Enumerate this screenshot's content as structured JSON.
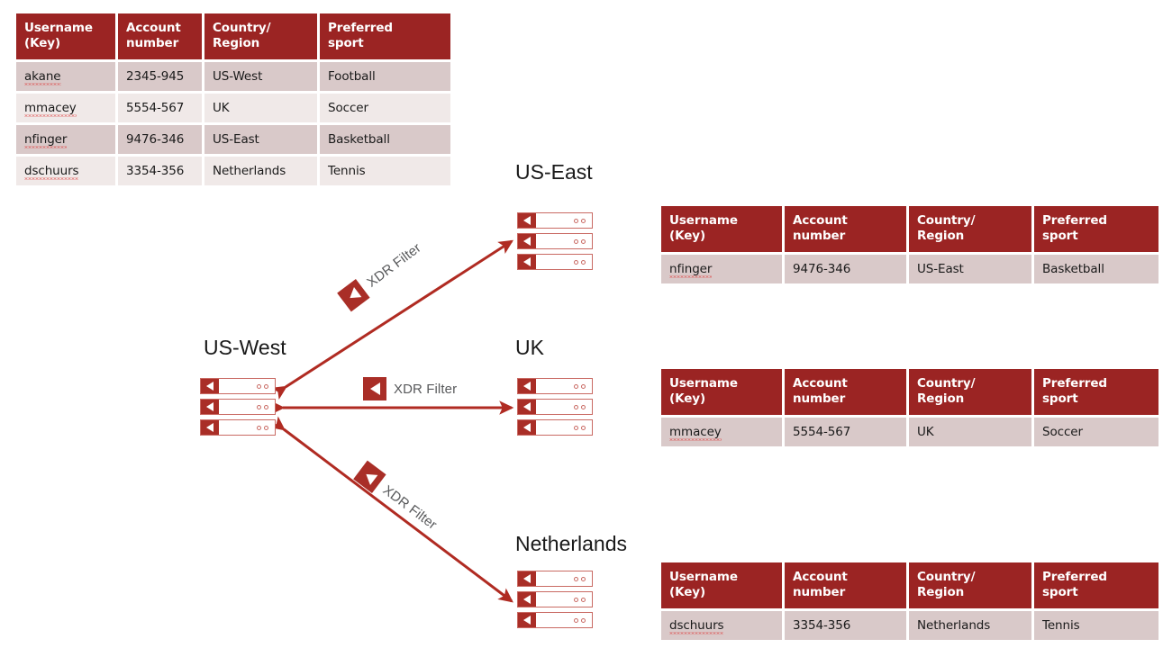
{
  "colors": {
    "header_red": "#9B2423",
    "node_red": "#A92E27",
    "node_border": "#C96A63",
    "arrow_red": "#B02B22",
    "row_odd": "#D9C9C9",
    "row_even": "#F0E9E8",
    "label_gray": "#58595B"
  },
  "tables": {
    "columns": [
      "Username (Key)",
      "Account number",
      "Country/ Region",
      "Preferred sport"
    ],
    "columns_lines": [
      [
        "Username",
        "(Key)"
      ],
      [
        "Account",
        "number"
      ],
      [
        "Country/",
        "Region"
      ],
      [
        "Preferred",
        "sport"
      ]
    ],
    "main": {
      "rows": [
        [
          "akane",
          "2345-945",
          "US-West",
          "Football"
        ],
        [
          "mmacey",
          "5554-567",
          "UK",
          "Soccer"
        ],
        [
          "nfinger",
          "9476-346",
          "US-East",
          "Basketball"
        ],
        [
          "dschuurs",
          "3354-356",
          "Netherlands",
          "Tennis"
        ]
      ]
    },
    "us_east": {
      "rows": [
        [
          "nfinger",
          "9476-346",
          "US-East",
          "Basketball"
        ]
      ]
    },
    "uk": {
      "rows": [
        [
          "mmacey",
          "5554-567",
          "UK",
          "Soccer"
        ]
      ]
    },
    "netherlands": {
      "rows": [
        [
          "dschuurs",
          "3354-356",
          "Netherlands",
          "Tennis"
        ]
      ]
    }
  },
  "regions": {
    "us_east": "US-East",
    "us_west": "US-West",
    "uk": "UK",
    "netherlands": "Netherlands"
  },
  "node_groups": {
    "us_east": {
      "count": 3,
      "icon": "server-node-icon"
    },
    "us_west": {
      "count": 3,
      "icon": "server-node-icon"
    },
    "uk": {
      "count": 3,
      "icon": "server-node-icon"
    },
    "netherlands": {
      "count": 3,
      "icon": "server-node-icon"
    }
  },
  "xdr_filters": {
    "to_us_east": {
      "label": "XDR Filter",
      "icon": "xdr-filter-icon"
    },
    "to_uk": {
      "label": "XDR Filter",
      "icon": "xdr-filter-icon"
    },
    "to_netherlands": {
      "label": "XDR Filter",
      "icon": "xdr-filter-icon"
    }
  },
  "connections": [
    {
      "name": "us-west-to-us-east",
      "from": "US-West",
      "to": "US-East",
      "bidirectional": true
    },
    {
      "name": "us-west-to-uk",
      "from": "US-West",
      "to": "UK",
      "bidirectional": true
    },
    {
      "name": "us-west-to-netherlands",
      "from": "US-West",
      "to": "Netherlands",
      "bidirectional": true
    }
  ]
}
